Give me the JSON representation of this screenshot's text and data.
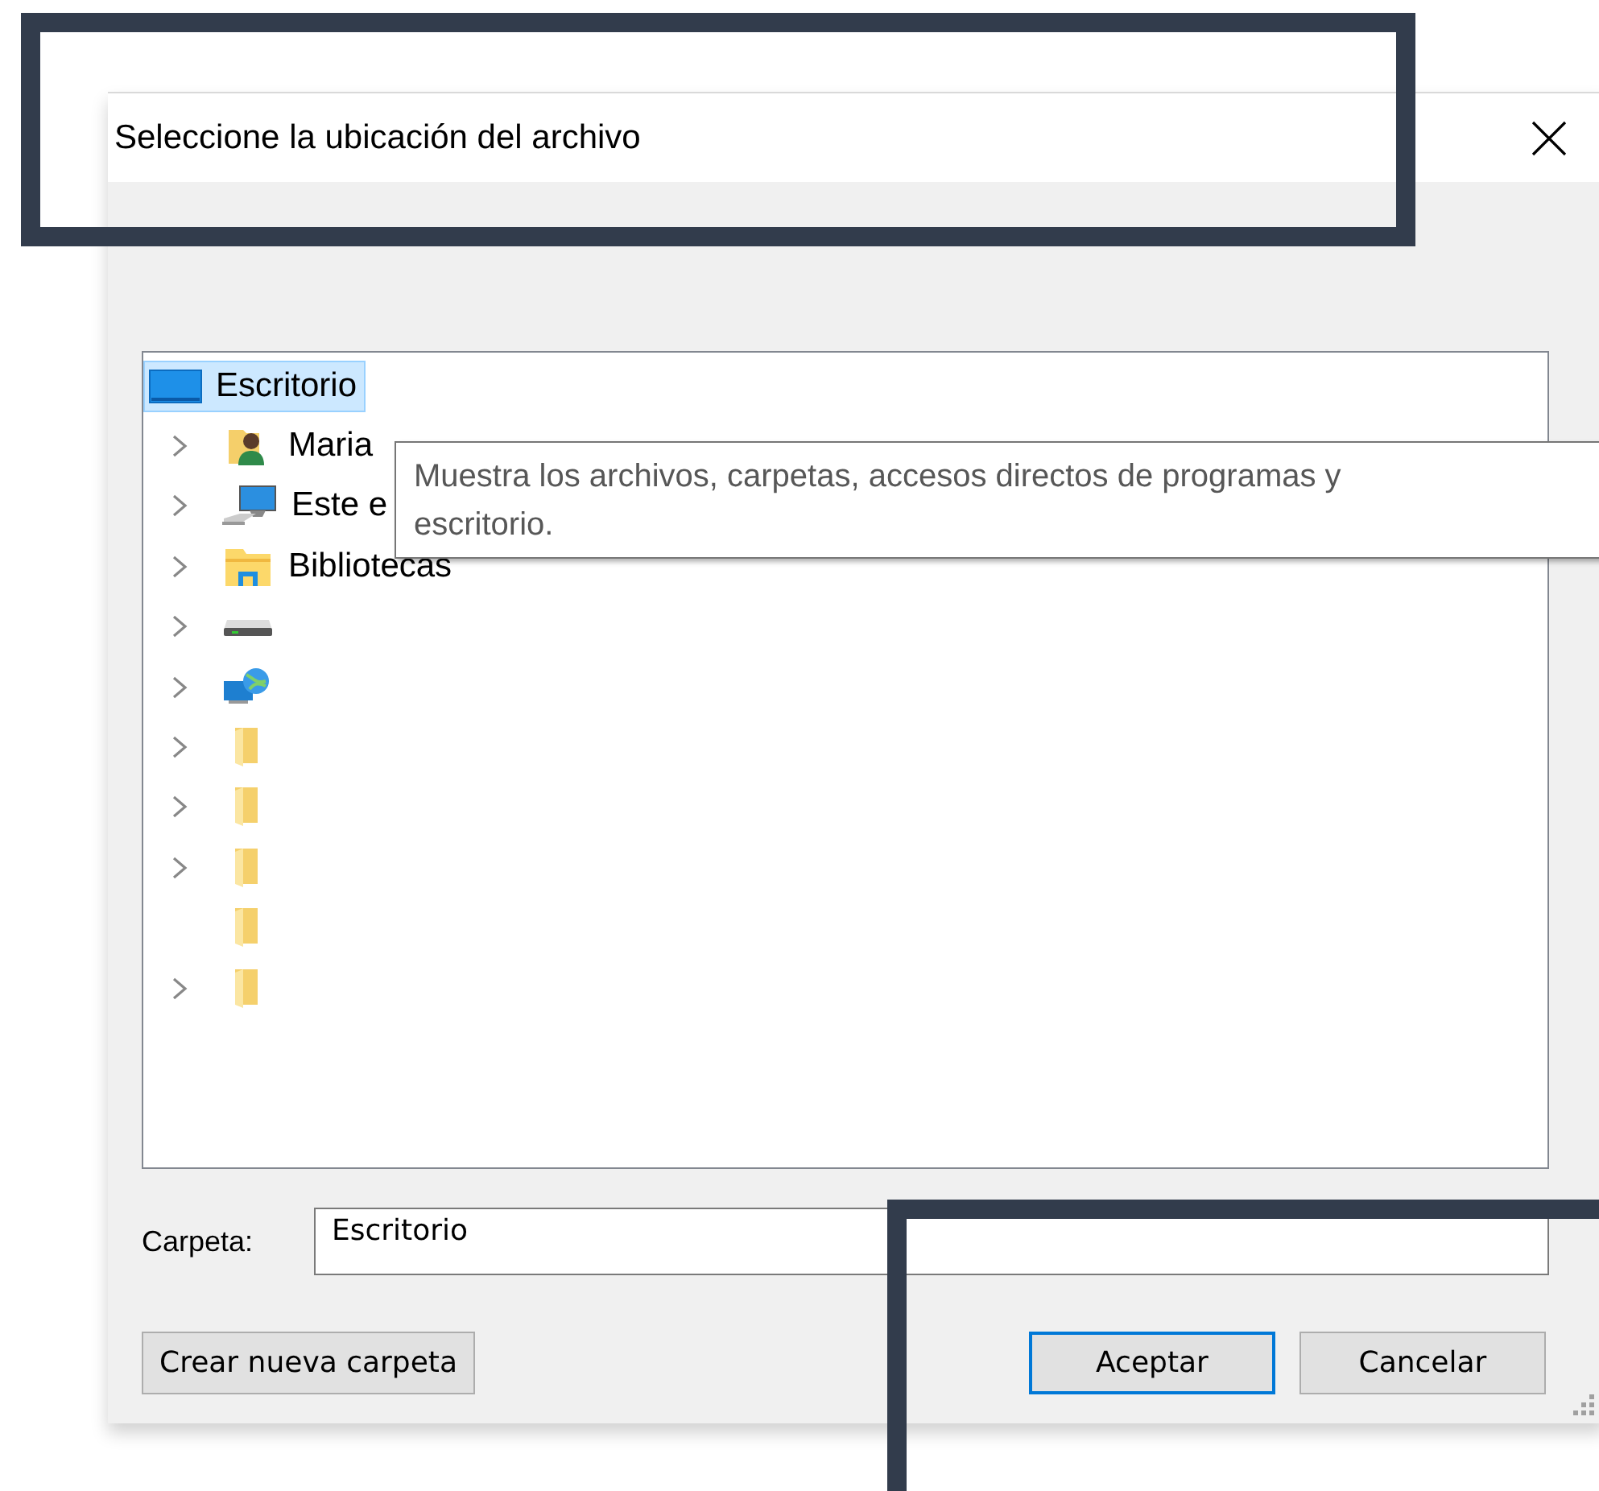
{
  "window": {
    "title": "Seleccione la ubicación del archivo"
  },
  "tree": {
    "items": [
      {
        "label": "Escritorio",
        "kind": "desktop",
        "selected": true,
        "children": [
          {
            "label": "Maria",
            "kind": "user",
            "expandable": true,
            "selected": false
          },
          {
            "label": "Este e",
            "kind": "computer",
            "expandable": true,
            "selected": false
          },
          {
            "label": "Bibliotecas",
            "kind": "libraries",
            "expandable": true,
            "selected": false
          },
          {
            "kind": "drive",
            "expandable": true,
            "selected": false
          },
          {
            "kind": "network",
            "expandable": true,
            "selected": false
          },
          {
            "kind": "folder",
            "expandable": true,
            "selected": false
          },
          {
            "kind": "folder",
            "expandable": true,
            "selected": false
          },
          {
            "kind": "folder",
            "expandable": true,
            "selected": false
          },
          {
            "kind": "folder",
            "expandable": false,
            "selected": false
          },
          {
            "kind": "folder",
            "expandable": true,
            "selected": false
          }
        ]
      }
    ]
  },
  "tooltip": {
    "text": "Muestra los archivos, carpetas, accesos directos de programas y\nescritorio."
  },
  "folder_field": {
    "label": "Carpeta:",
    "value": "Escritorio"
  },
  "buttons": [
    {
      "label": "Crear nueva carpeta",
      "kind": "left",
      "default": false
    },
    {
      "label": "Aceptar",
      "kind": "right",
      "default": true
    },
    {
      "label": "Cancelar",
      "kind": "right",
      "default": false
    }
  ]
}
